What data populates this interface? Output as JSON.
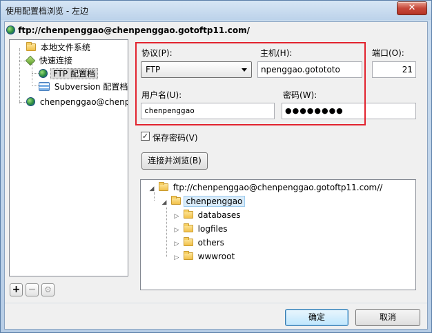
{
  "window": {
    "title": "使用配置档浏览 - 左边",
    "close_glyph": "✕"
  },
  "current_path": "ftp://chenpenggao@chenpenggao.gotoftp11.com/",
  "profile_tree": [
    {
      "label": "本地文件系统",
      "icon": "folder-icon"
    },
    {
      "label": "快速连接",
      "icon": "cube-icon"
    },
    {
      "label": "FTP 配置档",
      "icon": "globe-icon",
      "selected": true
    },
    {
      "label": "Subversion 配置档",
      "icon": "svn-icon"
    },
    {
      "label": "chenpenggao@chenp",
      "icon": "globe-icon"
    }
  ],
  "toolbar": {
    "add_label": "+",
    "remove_label": "−",
    "settings_label": "⚙"
  },
  "form": {
    "protocol_label": "协议(P):",
    "protocol_value": "FTP",
    "host_label": "主机(H):",
    "host_value": "npenggao.gotototo",
    "port_label": "端口(O):",
    "port_value": "21",
    "username_label": "用户名(U):",
    "username_value": "chenpenggao",
    "password_label": "密码(W):",
    "password_value": "●●●●●●●●",
    "save_password_label": "保存密码(V)",
    "save_password_checked": "✓",
    "connect_button": "连接并浏览(B)"
  },
  "browse_tree": {
    "root": "ftp://chenpenggao@chenpenggao.gotoftp11.com//",
    "user_folder": "chenpenggao",
    "children": [
      "databases",
      "logfiles",
      "others",
      "wwwroot"
    ]
  },
  "buttons": {
    "ok": "确定",
    "cancel": "取消"
  },
  "colors": {
    "highlight": "#e2232e",
    "title_gradient": "#bcd2ea"
  }
}
